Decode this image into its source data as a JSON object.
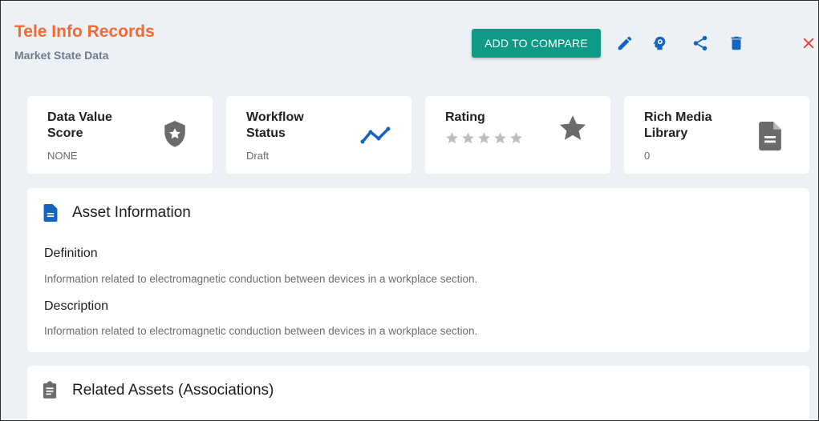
{
  "header": {
    "title": "Tele Info Records",
    "subtitle": "Market State Data",
    "compare_label": "ADD TO COMPARE"
  },
  "colors": {
    "title": "#f26a32",
    "accent": "#0f9a86",
    "icon_blue": "#1565c0",
    "close": "#e53935",
    "icon_gray": "#6b6b6b"
  },
  "toolbar": {
    "icons": [
      "edit-icon",
      "lightbulb-head-icon",
      "share-icon",
      "delete-icon",
      "close-icon"
    ]
  },
  "stats": [
    {
      "title": "Data Value Score",
      "value": "NONE",
      "icon": "shield-star-icon"
    },
    {
      "title": "Workflow Status",
      "value": "Draft",
      "icon": "trend-line-icon"
    },
    {
      "title": "Rating",
      "value": "",
      "rating": 0,
      "max_rating": 5,
      "icon": "star-icon"
    },
    {
      "title": "Rich Media Library",
      "value": "0",
      "icon": "document-icon"
    }
  ],
  "asset_info": {
    "heading": "Asset Information",
    "definition_label": "Definition",
    "definition": "Information related to electromagnetic conduction between devices in a workplace section.",
    "description_label": "Description",
    "description": "Information related to electromagnetic conduction between devices in a workplace section."
  },
  "related": {
    "heading": "Related Assets (Associations)"
  }
}
